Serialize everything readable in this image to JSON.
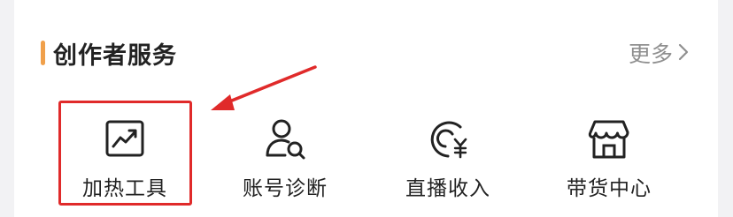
{
  "section": {
    "title": "创作者服务",
    "more_label": "更多",
    "accent_color": "#f0a04b"
  },
  "tools": [
    {
      "label": "加热工具",
      "icon": "trend-chart-icon"
    },
    {
      "label": "账号诊断",
      "icon": "user-search-icon"
    },
    {
      "label": "直播收入",
      "icon": "yuan-income-icon"
    },
    {
      "label": "带货中心",
      "icon": "shop-icon"
    }
  ],
  "annotation": {
    "highlight_color": "#e02a2a",
    "highlighted_item": "加热工具"
  }
}
